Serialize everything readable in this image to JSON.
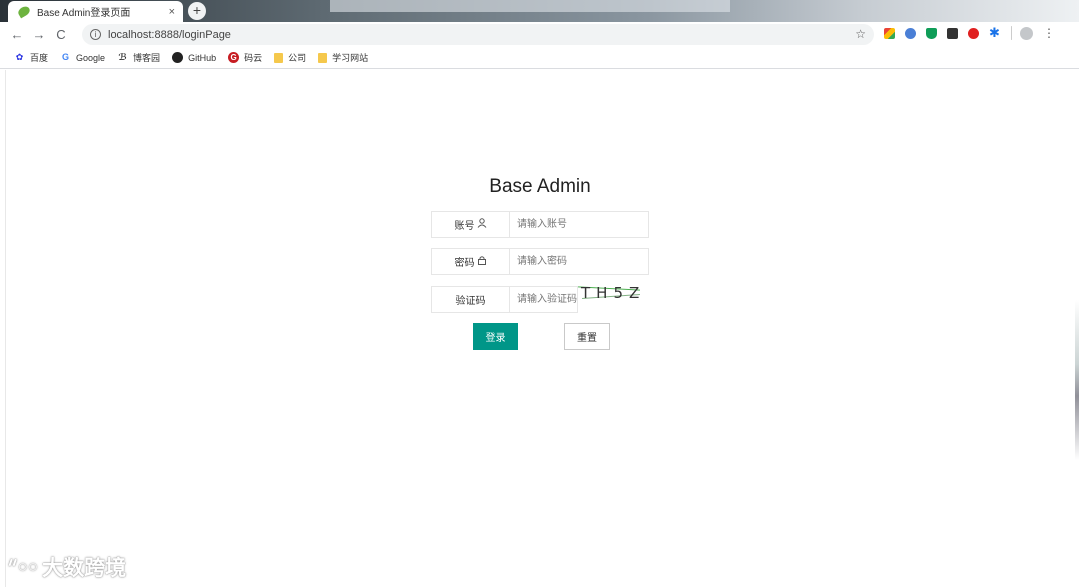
{
  "browser": {
    "tab_title": "Base Admin登录页面",
    "tab_close": "×",
    "new_tab": "+",
    "url": "localhost:8888/loginPage",
    "nav": {
      "back": "←",
      "forward": "→",
      "reload": "C"
    },
    "star": "☆"
  },
  "bookmarks": [
    {
      "label": "百度",
      "icon": "baidu-icon"
    },
    {
      "label": "Google",
      "icon": "google-icon"
    },
    {
      "label": "博客园",
      "icon": "cnblogs-icon"
    },
    {
      "label": "GitHub",
      "icon": "github-icon"
    },
    {
      "label": "码云",
      "icon": "gitee-icon"
    },
    {
      "label": "公司",
      "icon": "folder-icon"
    },
    {
      "label": "学习网站",
      "icon": "folder-icon"
    }
  ],
  "login": {
    "title": "Base Admin",
    "account_label": "账号",
    "account_placeholder": "请输入账号",
    "password_label": "密码",
    "password_placeholder": "请输入密码",
    "captcha_label": "验证码",
    "captcha_placeholder": "请输入验证码",
    "captcha_code": "TH5Z",
    "login_button": "登录",
    "reset_button": "重置"
  },
  "watermark": "大数跨境",
  "colors": {
    "primary": "#009688",
    "border": "#e6e6e6"
  }
}
